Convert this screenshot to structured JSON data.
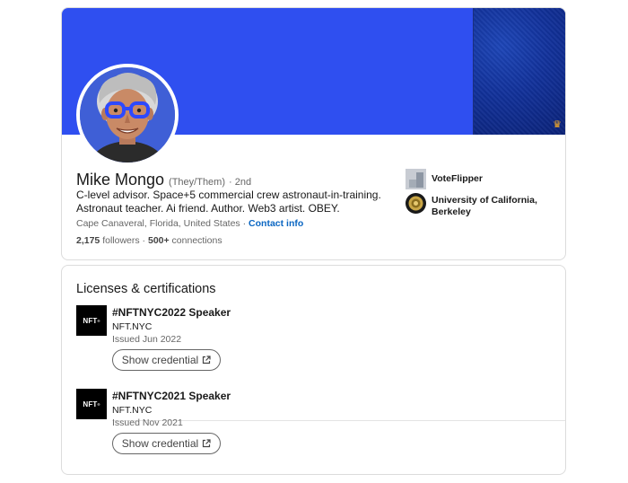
{
  "profile": {
    "name": "Mike Mongo",
    "pronouns": "(They/Them)",
    "degree": "· 2nd",
    "headline": "C-level advisor. Space+5 commercial crew astronaut-in-training. Astronaut teacher. Ai friend. Author. Web3 artist. OBEY.",
    "location": "Cape Canaveral, Florida, United States",
    "location_separator": " · ",
    "contact_link": "Contact info",
    "followers_count": "2,175",
    "followers_label": " followers",
    "stats_separator": " · ",
    "connections_count": "500+",
    "connections_label": " connections"
  },
  "organizations": [
    {
      "name": "VoteFlipper",
      "icon": "voteflipper-logo"
    },
    {
      "name": "University of California, Berkeley",
      "icon": "uc-berkeley-seal"
    }
  ],
  "licenses": {
    "title": "Licenses & certifications",
    "items": [
      {
        "logo_text": "NFT",
        "name": "#NFTNYC2022 Speaker",
        "issuer": "NFT.NYC",
        "date": "Issued Jun 2022",
        "button_label": "Show credential"
      },
      {
        "logo_text": "NFT",
        "name": "#NFTNYC2021 Speaker",
        "issuer": "NFT.NYC",
        "date": "Issued Nov 2021",
        "button_label": "Show credential"
      }
    ]
  },
  "colors": {
    "banner_blue": "#2f4ff0",
    "link_blue": "#0a66c2",
    "text_primary": "#191919",
    "text_secondary": "#666666"
  },
  "icons": {
    "external_link": "external-link-icon",
    "banner_badge": "crown-icon"
  }
}
